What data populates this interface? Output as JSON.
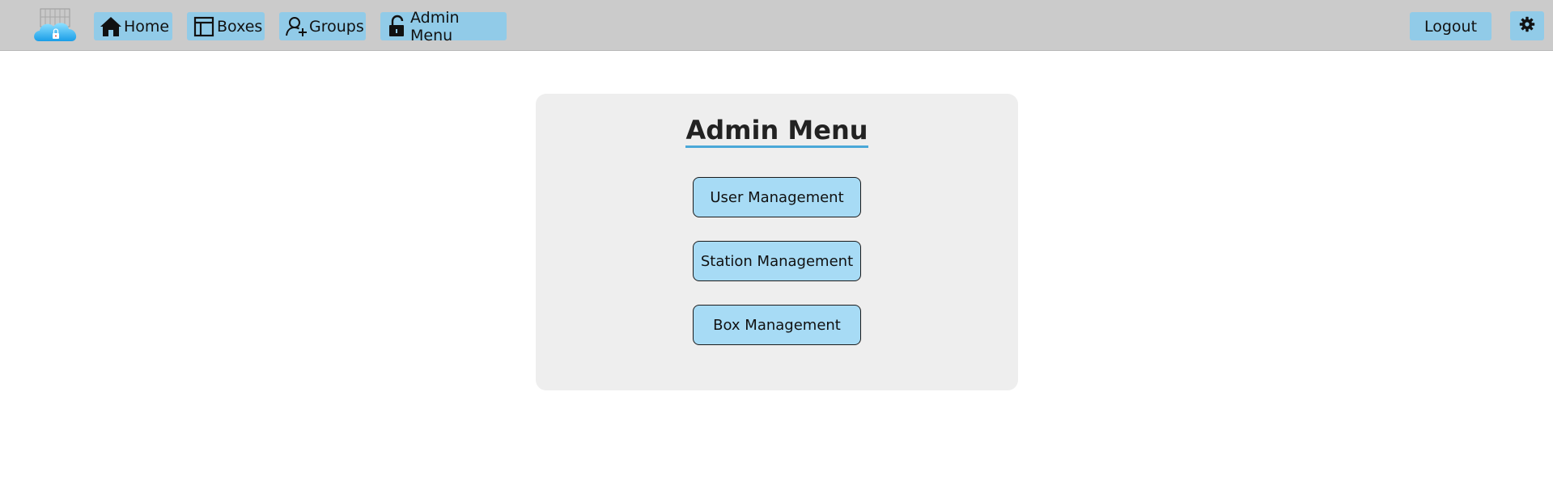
{
  "nav": {
    "items": [
      {
        "label": "Home",
        "icon": "home-icon"
      },
      {
        "label": "Boxes",
        "icon": "boxes-icon"
      },
      {
        "label": "Groups",
        "icon": "groups-icon"
      },
      {
        "label": "Admin Menu",
        "icon": "unlock-icon"
      }
    ],
    "logout_label": "Logout",
    "settings_icon": "gear-icon",
    "logo_icon": "cloud-lock-logo-icon"
  },
  "admin_panel": {
    "title": "Admin Menu",
    "buttons": [
      {
        "label": "User Management"
      },
      {
        "label": "Station Management"
      },
      {
        "label": "Box Management"
      }
    ]
  },
  "colors": {
    "topbar": "#cbcbcb",
    "nav_button": "#91cbe8",
    "menu_button": "#a7dbf5",
    "panel": "#eeeeee",
    "title_underline": "#4aa8d8"
  }
}
